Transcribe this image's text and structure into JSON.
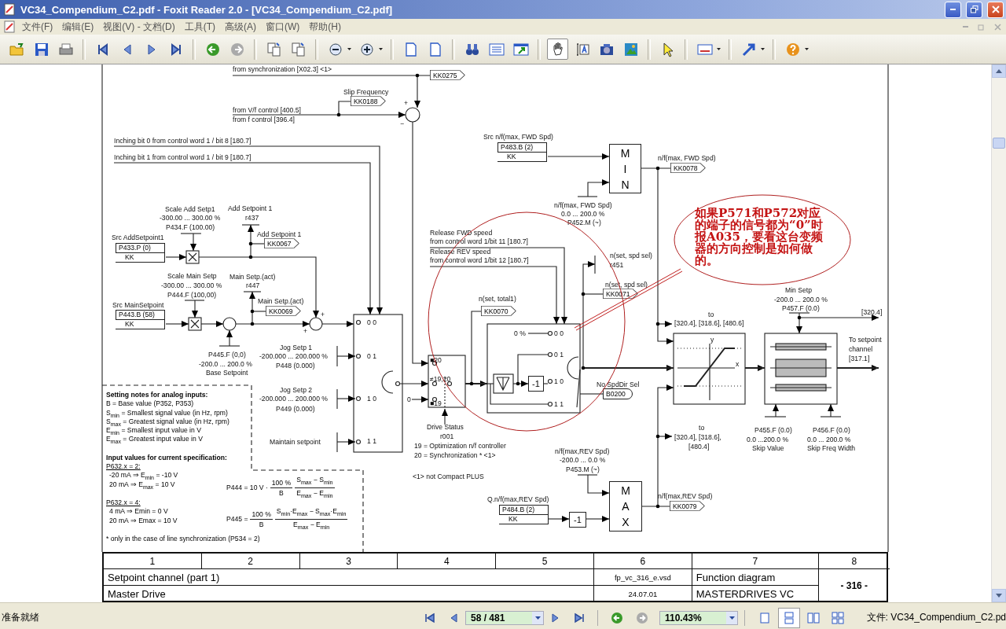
{
  "window": {
    "title": "VC34_Compendium_C2.pdf - Foxit Reader 2.0 - [VC34_Compendium_C2.pdf]"
  },
  "menu": [
    "文件(F)",
    "编辑(E)",
    "视图(V) - 文档(D)",
    "工具(T)",
    "高级(A)",
    "窗口(W)",
    "帮助(H)"
  ],
  "tools": [
    {
      "selected": true
    },
    {
      "selected": false
    },
    {
      "selected": false
    }
  ],
  "document": {
    "labels": [
      "from synchronization [X02.3]  <1>",
      "Slip Frequency",
      "+",
      "from V/f control [400.5]",
      "from f control [396.4]",
      "−",
      "Inching bit 0 from control word 1 / bit 8 [180.7]",
      "Src n/f(max, FWD Spd)",
      "Inching bit 1 from control word 1 / bit 9 [180.7]",
      "n/f(max, FWD Spd)",
      "Scale Add Setp1",
      "Add Setpoint 1",
      "n/f(max, FWD Spd)",
      "-300.00 ... 300.00 %",
      "r437",
      "0.0 ... 200.0 %",
      "P434.F (100.00)",
      "P452.M (~)",
      "Src AddSetpoint1",
      "Add Setpoint 1",
      "Release FWD speed",
      "from control word 1/bit 11 [180.7]",
      "Release REV speed",
      "n(set, spd sel)",
      "from control word 1/bit 12 [180.7]",
      "r451",
      "Scale Main Setp",
      "Main Setp.(act)",
      "-300.00 ... 300.00 %",
      "r447",
      "n(set, spd sel)",
      "P444.F (100,00)",
      "Min Setp",
      "Main Setp.(act)",
      "n(set, total1)",
      "-200.0 ... 200.0 %",
      "Src MainSetpoint",
      "P457.F (0.0)",
      "+",
      "to",
      "[320.4]",
      "0 0",
      "[320.4], [318.6], [480.6]",
      "+",
      "0 %",
      "0 0",
      "y",
      "Jog Setp 1",
      "P445.F (0,0)",
      "-200.000 ... 200.000 %",
      "0 1",
      "0 1",
      "-200.0 ... 200.0 %",
      "P448 (0.000)",
      "■20",
      "x",
      "Base Setpoint",
      "≠19,20",
      "1 0",
      "No SpdDir Sel",
      "Jog Setp 2",
      "-200.000 ... 200.000 %",
      "1 0",
      "0",
      "P449 (0.000)",
      "■19",
      "1 1",
      "Drive Status",
      "to",
      "P455.F (0.0)",
      "P456.F (0.0)",
      "Maintain setpoint",
      "1 1",
      "r001",
      "[320.4], [318.6],",
      "0.0 ...200.0 %",
      "0.0 ... 200.0 %",
      "19 = Optimization n/f controller",
      "[480.4]",
      "Skip Value",
      "Skip Freq Width",
      "20 = Synchronization * <1>",
      "n/f(max,REV Spd)",
      "-200.0 ... 0.0 %",
      "P453.M (~)",
      "<1> not Compact PLUS",
      "Q.n/f(max,REV Spd)",
      "n/f(max,REV Spd)"
    ],
    "output_note": "To setpoint channel [317.1]",
    "tags": [
      {
        "text": "KK0275",
        "kind": "connector"
      },
      {
        "text": "KK0188",
        "kind": "connector"
      },
      {
        "text": "KK0078",
        "kind": "connector"
      },
      {
        "text": "KK0067",
        "kind": "connector"
      },
      {
        "text": "KK0071",
        "kind": "connector"
      },
      {
        "text": "KK0069",
        "kind": "connector"
      },
      {
        "text": "KK0070",
        "kind": "connector"
      },
      {
        "text": "B0200",
        "kind": "binector"
      },
      {
        "text": "KK0079",
        "kind": "connector"
      }
    ],
    "parameter_boxes": [
      {
        "param": "P483.B (2)",
        "type": "KK"
      },
      {
        "param": "P433.P (0)",
        "type": "KK"
      },
      {
        "param": "P443.B (58)",
        "type": "KK"
      },
      {
        "param": "P484.B (2)",
        "type": "KK"
      }
    ],
    "blocks": [
      {
        "kind": "min",
        "text": "MIN"
      },
      {
        "kind": "negate",
        "text": "-1"
      },
      {
        "kind": "negate",
        "text": "-1"
      },
      {
        "kind": "max",
        "text": "MAX"
      }
    ],
    "notes": {
      "heading": "Setting notes for  analog inputs:",
      "lines": [
        "B = Base value (P352, P353)",
        "S$_{min}$ = Smallest signal value (in Hz, rpm)",
        "S$_{max}$ = Greatest signal value (in Hz, rpm)",
        "E$_{min}$ = Smallest input value in V",
        "E$_{max}$ = Greatest input value in V"
      ],
      "spec_heading": "Input values for current specification:",
      "cases": [
        {
          "condition": "P632.x = 2:",
          "lines": [
            "-20 mA ⇒ E$_{min}$  = -10 V",
            "20 mA ⇒ E$_{max}$  =  10 V"
          ]
        },
        {
          "condition": "P632.x = 4:",
          "lines": [
            "4 mA ⇒ Emin  =   0 V",
            "20 mA ⇒ Emax  =  10 V"
          ]
        }
      ],
      "footnote": "* only in the case of line synchronization (P534 = 2)"
    },
    "formulas": [
      {
        "lhs": "P444 = 10 V ·",
        "factor_num": "100 %",
        "factor_den": "B",
        "num": "S$_{max}$ − S$_{min}$",
        "den": "E$_{max}$ − E$_{min}$"
      },
      {
        "lhs": "P445 =",
        "factor_num": "100 %",
        "factor_den": "B",
        "num": "S$_{min}$·E$_{max}$ − S$_{max}$·E$_{min}$",
        "den": "E$_{max}$ − E$_{min}$"
      }
    ],
    "annotation": "如果P571和P572对应的端子的信号都为“0”时报A035，要看这台变频器的方向控制是如何做的。",
    "title_block": {
      "columns": [
        "1",
        "2",
        "3",
        "4",
        "5",
        "6",
        "7",
        "8"
      ],
      "title": "Setpoint channel (part 1)",
      "file": "fp_vc_316_e.vsd",
      "diagram_type": "Function diagram",
      "product": "Master Drive",
      "date": "24.07.01",
      "series": "MASTERDRIVES VC",
      "page": "- 316 -"
    }
  },
  "status_bar": {
    "message": "准备就绪",
    "page": "58 / 481",
    "zoom": "110.43%",
    "file": "文件: VC34_Compendium_C2.pd",
    "view_modes": [
      {
        "selected": false
      },
      {
        "selected": true
      },
      {
        "selected": false
      },
      {
        "selected": false
      }
    ]
  }
}
